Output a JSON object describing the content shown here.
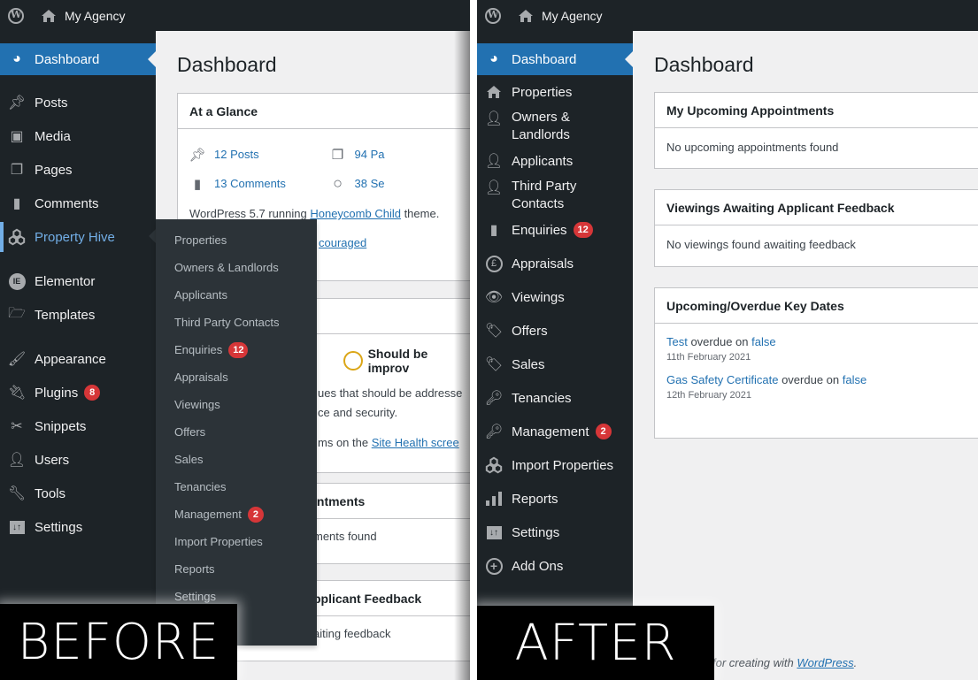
{
  "colors": {
    "sidebar_bg": "#1d2327",
    "active_bg": "#2271b1",
    "badge": "#d63638",
    "link": "#2271b1",
    "flyout_bg": "#2c3338",
    "health_ring": "#dba617"
  },
  "before": {
    "label": "BEFORE",
    "adminbar": {
      "site_name": "My Agency",
      "wp_icon": "wordpress-logo-icon",
      "home_icon": "home-icon"
    },
    "sidebar": {
      "items": [
        {
          "label": "Dashboard",
          "icon": "dashboard-icon",
          "active": true
        },
        {
          "label": "Posts",
          "icon": "pin-icon"
        },
        {
          "label": "Media",
          "icon": "media-icon"
        },
        {
          "label": "Pages",
          "icon": "pages-icon"
        },
        {
          "label": "Comments",
          "icon": "comment-icon"
        },
        {
          "label": "Property Hive",
          "icon": "property-hive-icon",
          "open": true
        },
        {
          "label": "Elementor",
          "icon": "elementor-icon"
        },
        {
          "label": "Templates",
          "icon": "folder-icon"
        },
        {
          "label": "Appearance",
          "icon": "paintbrush-icon"
        },
        {
          "label": "Plugins",
          "icon": "plugin-icon",
          "badge": "8"
        },
        {
          "label": "Snippets",
          "icon": "scissors-icon"
        },
        {
          "label": "Users",
          "icon": "user-icon"
        },
        {
          "label": "Tools",
          "icon": "wrench-icon"
        },
        {
          "label": "Settings",
          "icon": "settings-icon"
        }
      ]
    },
    "flyout": {
      "items": [
        {
          "label": "Properties"
        },
        {
          "label": "Owners & Landlords"
        },
        {
          "label": "Applicants"
        },
        {
          "label": "Third Party Contacts"
        },
        {
          "label": "Enquiries",
          "badge": "12"
        },
        {
          "label": "Appraisals"
        },
        {
          "label": "Viewings"
        },
        {
          "label": "Offers"
        },
        {
          "label": "Sales"
        },
        {
          "label": "Tenancies"
        },
        {
          "label": "Management",
          "badge": "2"
        },
        {
          "label": "Import Properties"
        },
        {
          "label": "Reports"
        },
        {
          "label": "Settings"
        }
      ]
    },
    "page_title": "Dashboard",
    "at_a_glance": {
      "title": "At a Glance",
      "posts": "12 Posts",
      "pages": "94 Pa",
      "comments": "13 Comments",
      "other": "38 Se",
      "wp_version_prefix": "WordPress 5.7 running ",
      "theme_link": "Honeycomb Child",
      "theme_suffix": " theme.",
      "search_link": "couraged"
    },
    "site_health": {
      "status": "Should be improv",
      "line1": "ues that should be addresse",
      "line2": "ce and security.",
      "line3_prefix": "ms on the ",
      "line3_link": "Site Health scree"
    },
    "appointments": {
      "title": "intments",
      "body": "ments found"
    },
    "feedback": {
      "title": "pplicant Feedback",
      "body": "aiting feedback"
    }
  },
  "after": {
    "label": "AFTER",
    "adminbar": {
      "site_name": "My Agency",
      "wp_icon": "wordpress-logo-icon",
      "home_icon": "home-icon"
    },
    "sidebar": {
      "items": [
        {
          "label": "Dashboard",
          "icon": "dashboard-icon",
          "active": true
        },
        {
          "label": "Properties",
          "icon": "home-icon"
        },
        {
          "label": "Owners & Landlords",
          "icon": "user-icon",
          "two_line": true
        },
        {
          "label": "Applicants",
          "icon": "user-icon"
        },
        {
          "label": "Third Party Contacts",
          "icon": "user-icon",
          "two_line": true
        },
        {
          "label": "Enquiries",
          "icon": "comment-icon",
          "badge": "12"
        },
        {
          "label": "Appraisals",
          "icon": "pound-icon"
        },
        {
          "label": "Viewings",
          "icon": "eye-icon"
        },
        {
          "label": "Offers",
          "icon": "tag-icon"
        },
        {
          "label": "Sales",
          "icon": "tag-icon"
        },
        {
          "label": "Tenancies",
          "icon": "key-icon"
        },
        {
          "label": "Management",
          "icon": "key-icon",
          "badge": "2"
        },
        {
          "label": "Import Properties",
          "icon": "property-hive-icon"
        },
        {
          "label": "Reports",
          "icon": "chart-bar-icon"
        },
        {
          "label": "Settings",
          "icon": "settings-icon"
        },
        {
          "label": "Add Ons",
          "icon": "plus-circle-icon"
        }
      ]
    },
    "page_title": "Dashboard",
    "widgets": {
      "appointments": {
        "title": "My Upcoming Appointments",
        "body": "No upcoming appointments found"
      },
      "feedback": {
        "title": "Viewings Awaiting Applicant Feedback",
        "body": "No viewings found awaiting feedback"
      },
      "key_dates": {
        "title": "Upcoming/Overdue Key Dates",
        "items": [
          {
            "name": "Test",
            "middle": " overdue on ",
            "value": "false",
            "date": "11th February 2021"
          },
          {
            "name": "Gas Safety Certificate",
            "middle": " overdue on ",
            "value": "false",
            "date": "12th February 2021"
          }
        ]
      }
    },
    "footer": {
      "prefix": "for creating with ",
      "link": "WordPress",
      "suffix": "."
    }
  }
}
